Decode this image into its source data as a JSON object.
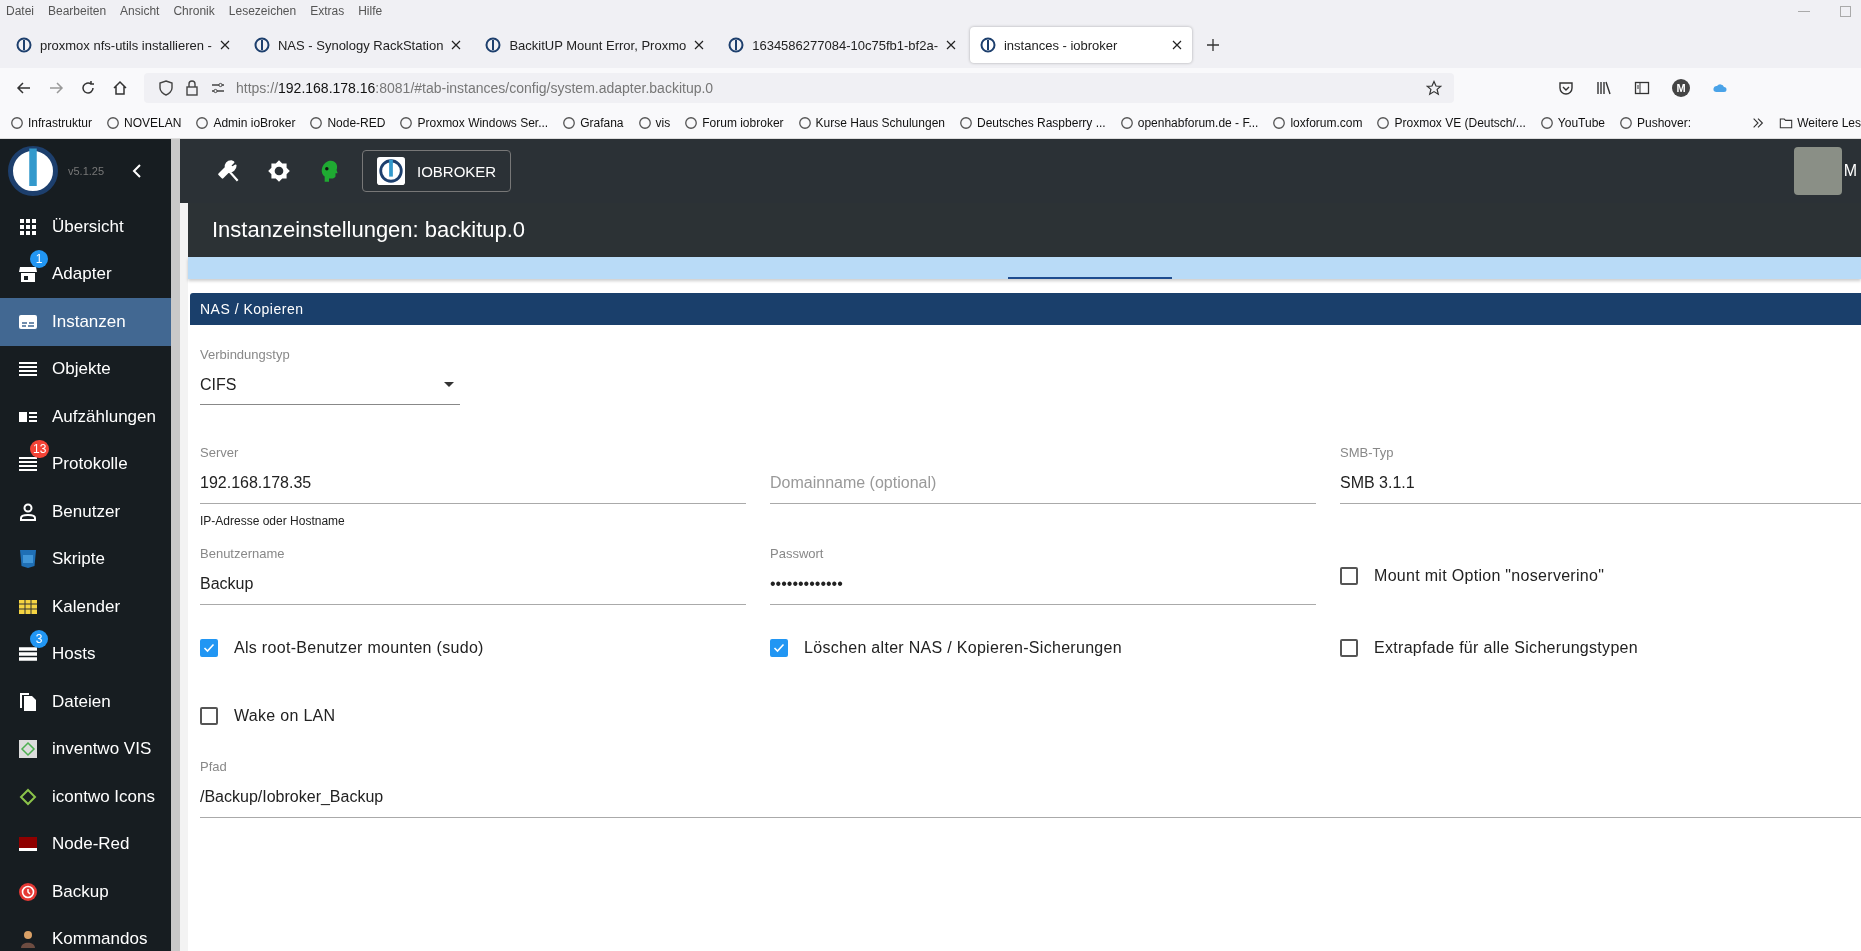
{
  "menu_bar": [
    "Datei",
    "Bearbeiten",
    "Ansicht",
    "Chronik",
    "Lesezeichen",
    "Extras",
    "Hilfe"
  ],
  "browser_tabs": [
    {
      "title": "proxmox nfs-utils installieren -",
      "selected": false
    },
    {
      "title": "NAS - Synology RackStation",
      "selected": false
    },
    {
      "title": "BackitUP Mount Error, Proxmo",
      "selected": false
    },
    {
      "title": "1634586277084-10c75fb1-bf2a-",
      "selected": false
    },
    {
      "title": "instances - iobroker",
      "selected": true
    }
  ],
  "address_bar": {
    "scheme": "https://",
    "host": "192.168.178.16",
    "rest": ":8081/#tab-instances/config/system.adapter.backitup.0"
  },
  "profile_initial": "M",
  "bookmarks": [
    "Infrastruktur",
    "NOVELAN",
    "Admin ioBroker",
    "Node-RED",
    "Proxmox Windows Ser...",
    "Grafana",
    "vis",
    "Forum iobroker",
    "Kurse Haus Schulungen",
    "Deutsches Raspberry ...",
    "openhabforum.de - F...",
    "loxforum.com",
    "Proxmox VE (Deutsch/...",
    "YouTube",
    "Pushover:"
  ],
  "other_bookmarks": "Weitere Les",
  "sidebar": {
    "version": "v5.1.25",
    "items": [
      {
        "label": "Übersicht",
        "selected": false
      },
      {
        "label": "Adapter",
        "selected": false,
        "badge": "1",
        "color": "#2196f3"
      },
      {
        "label": "Instanzen",
        "selected": true
      },
      {
        "label": "Objekte",
        "selected": false
      },
      {
        "label": "Aufzählungen",
        "selected": false
      },
      {
        "label": "Protokolle",
        "selected": false,
        "badge": "13",
        "color": "#f44336"
      },
      {
        "label": "Benutzer",
        "selected": false
      },
      {
        "label": "Skripte",
        "selected": false
      },
      {
        "label": "Kalender",
        "selected": false
      },
      {
        "label": "Hosts",
        "selected": false,
        "badge": "3",
        "color": "#2196f3"
      },
      {
        "label": "Dateien",
        "selected": false
      },
      {
        "label": "inventwo VIS",
        "selected": false
      },
      {
        "label": "icontwo Icons",
        "selected": false
      },
      {
        "label": "Node-Red",
        "selected": false
      },
      {
        "label": "Backup",
        "selected": false
      },
      {
        "label": "Kommandos",
        "selected": false
      }
    ]
  },
  "toolbar": {
    "host_button": "IOBROKER",
    "user_initial": "M"
  },
  "dialog": {
    "title": "Instanzeinstellungen: backitup.0",
    "tabs": [
      {
        "selected": false
      },
      {
        "selected": false
      },
      {
        "selected": false
      },
      {
        "selected": false
      },
      {
        "selected": false
      },
      {
        "selected": true
      },
      {
        "selected": false
      },
      {
        "selected": false
      }
    ],
    "section": "NAS / Kopieren",
    "rows": [
      [
        {
          "kind": "select",
          "label": "Verbindungstyp",
          "value": "CIFS"
        }
      ],
      [
        {
          "kind": "text",
          "label": "Server",
          "value": "192.168.178.35",
          "helper": "IP-Adresse oder Hostname"
        },
        {
          "kind": "text",
          "placeholder": "Domainname (optional)"
        },
        {
          "kind": "text",
          "label": "SMB-Typ",
          "value": "SMB 3.1.1"
        }
      ],
      [
        {
          "kind": "text",
          "label": "Benutzername",
          "value": "Backup"
        },
        {
          "kind": "text",
          "label": "Passwort",
          "value": "•••••••••••••"
        },
        {
          "kind": "checkbox",
          "label": "Mount mit Option \"noserverino\"",
          "checked": false
        }
      ],
      [
        {
          "kind": "checkbox",
          "label": "Als root-Benutzer mounten (sudo)",
          "checked": true
        },
        {
          "kind": "checkbox",
          "label": "Löschen alter NAS / Kopieren-Sicherungen",
          "checked": true
        },
        {
          "kind": "checkbox",
          "label": "Extrapfade für alle Sicherungstypen",
          "checked": false
        }
      ],
      [
        {
          "kind": "checkbox",
          "label": "Wake on LAN",
          "checked": false
        }
      ],
      [
        {
          "kind": "text",
          "label": "Pfad",
          "value": "/Backup/Iobroker_Backup",
          "wide": true
        }
      ]
    ]
  }
}
